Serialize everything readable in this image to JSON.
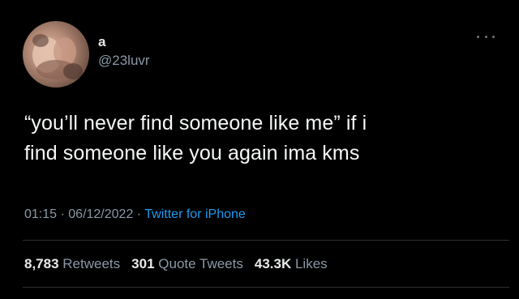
{
  "author": {
    "display_name": "a",
    "handle": "@23luvr",
    "avatar_icon": "user-avatar-photo"
  },
  "tweet": {
    "text_line1": "“you’ll never find someone like me” if i",
    "text_line2": "find someone like you again ima kms"
  },
  "meta": {
    "time": "01:15",
    "separator": " · ",
    "date": "06/12/2022",
    "source": "Twitter for iPhone"
  },
  "stats": {
    "retweets_count": "8,783",
    "retweets_label": "Retweets",
    "quote_count": "301",
    "quote_label": "Quote Tweets",
    "likes_count": "43.3K",
    "likes_label": "Likes"
  },
  "colors": {
    "background": "#000000",
    "text": "#e7e9ea",
    "secondary": "#8b98a5",
    "link": "#1d9bf0"
  },
  "icons": {
    "more": "more-options-icon"
  }
}
